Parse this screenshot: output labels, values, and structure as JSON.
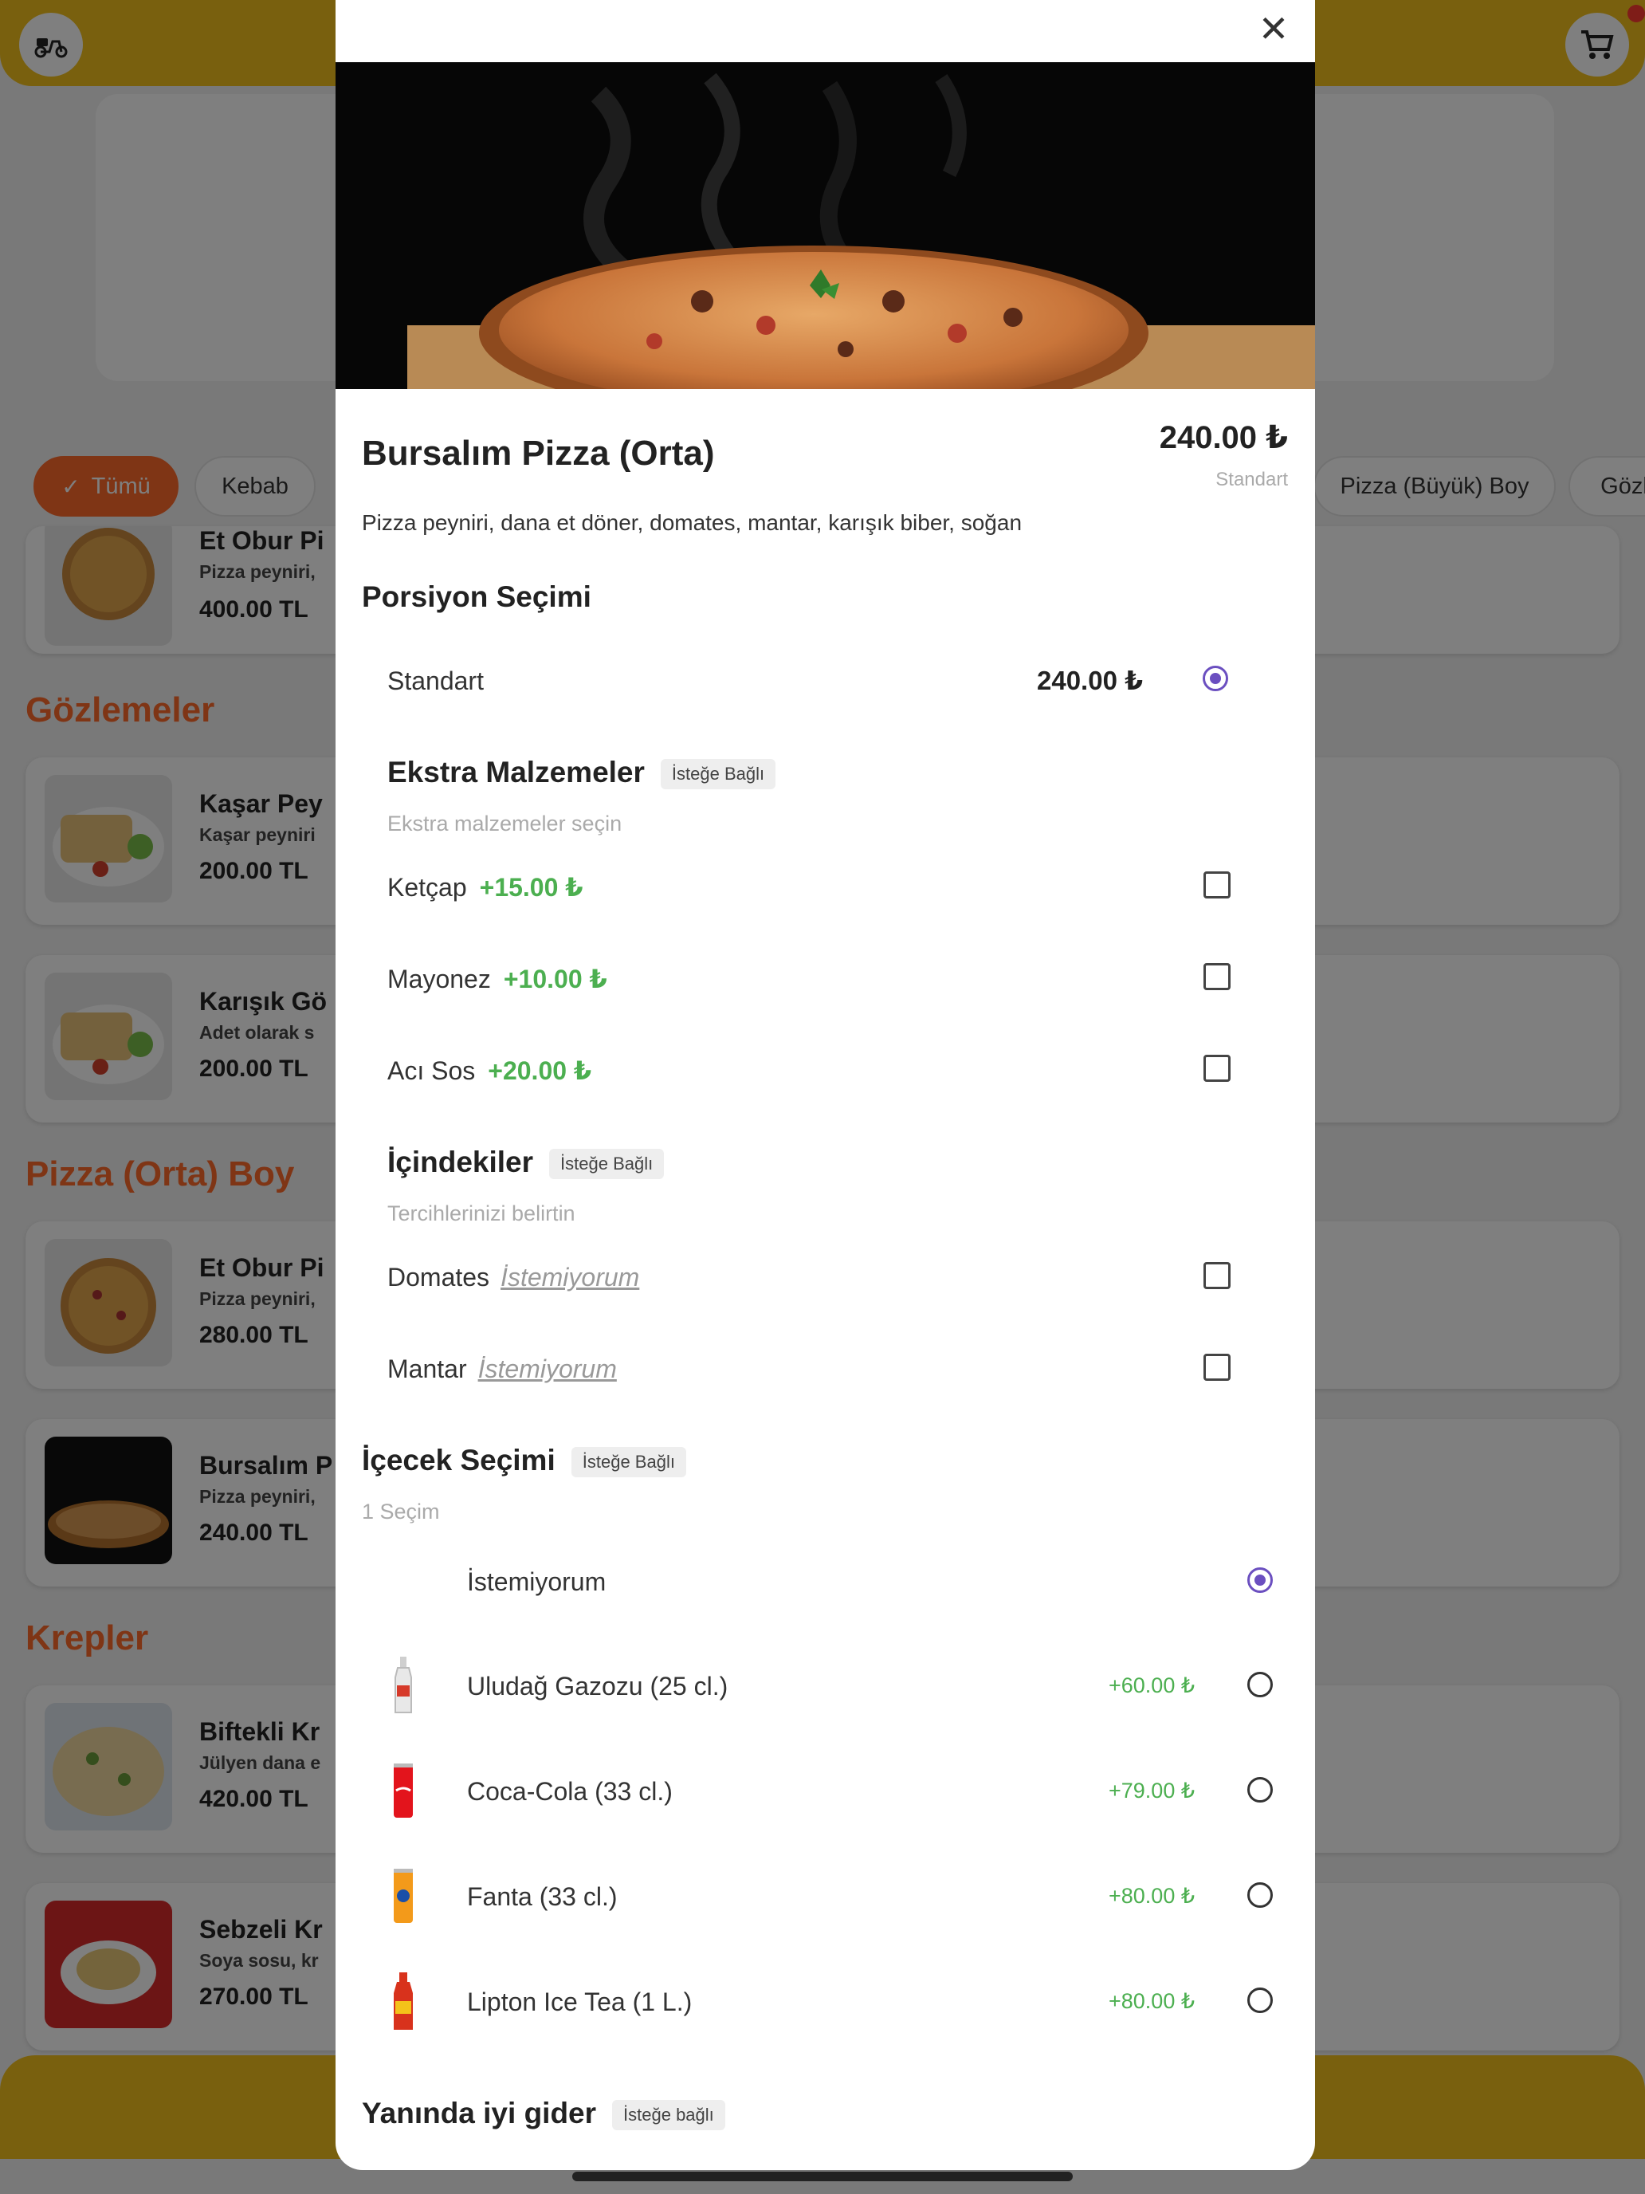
{
  "background": {
    "chips": [
      {
        "label": "Tümü",
        "active": true
      },
      {
        "label": "Kebab",
        "active": false
      },
      {
        "label": "Pizza (Büyük) Boy",
        "active": false
      },
      {
        "label": "Gözl",
        "active": false
      }
    ],
    "sections": [
      {
        "title": "Gözlemeler"
      },
      {
        "title": "Pizza (Orta) Boy"
      },
      {
        "title": "Krepler"
      }
    ],
    "items": [
      {
        "name": "Et Obur Pi",
        "desc": "Pizza peyniri,",
        "price": "400.00 TL"
      },
      {
        "name": "Kaşar Pey",
        "desc": "Kaşar peyniri",
        "price": "200.00 TL"
      },
      {
        "name": "Karışık Gö",
        "desc": "Adet olarak s",
        "price": "200.00 TL"
      },
      {
        "name": "Et Obur Pi",
        "desc": "Pizza peyniri,",
        "price": "280.00 TL"
      },
      {
        "name": "Bursalım P",
        "desc": "Pizza peyniri,",
        "price": "240.00 TL"
      },
      {
        "name": "Biftekli Kr",
        "desc": "Jülyen dana e",
        "price": "420.00 TL"
      },
      {
        "name": "Sebzeli Kr",
        "desc": "Soya sosu, kr",
        "price": "270.00 TL"
      }
    ]
  },
  "modal": {
    "close_symbol": "✕",
    "title": "Bursalım Pizza (Orta)",
    "price": "240.00 ₺",
    "price_note": "Standart",
    "description": "Pizza peyniri, dana et döner, domates, mantar, karışık biber, soğan",
    "portion": {
      "heading": "Porsiyon Seçimi",
      "options": [
        {
          "label": "Standart",
          "price": "240.00 ₺",
          "selected": true
        }
      ]
    },
    "extras": {
      "heading": "Ekstra Malzemeler",
      "tag": "İsteğe Bağlı",
      "subtitle": "Ekstra malzemeler seçin",
      "options": [
        {
          "label": "Ketçap",
          "price": "+15.00 ₺",
          "checked": false
        },
        {
          "label": "Mayonez",
          "price": "+10.00 ₺",
          "checked": false
        },
        {
          "label": "Acı Sos",
          "price": "+20.00 ₺",
          "checked": false
        }
      ]
    },
    "ingredients": {
      "heading": "İçindekiler",
      "tag": "İsteğe Bağlı",
      "subtitle": "Tercihlerinizi belirtin",
      "options": [
        {
          "label": "Domates",
          "note": "İstemiyorum",
          "checked": false
        },
        {
          "label": "Mantar",
          "note": "İstemiyorum",
          "checked": false
        }
      ]
    },
    "drinks": {
      "heading": "İçecek Seçimi",
      "tag": "İsteğe Bağlı",
      "subtitle": "1 Seçim",
      "options": [
        {
          "label": "İstemiyorum",
          "price": "",
          "selected": true,
          "icon": "none"
        },
        {
          "label": "Uludağ Gazozu (25 cl.)",
          "price": "+60.00 ₺",
          "selected": false,
          "icon": "glass-bottle-icon",
          "color": "#e8e8e8"
        },
        {
          "label": "Coca-Cola (33 cl.)",
          "price": "+79.00 ₺",
          "selected": false,
          "icon": "can-icon",
          "color": "#e3141c"
        },
        {
          "label": "Fanta (33 cl.)",
          "price": "+80.00 ₺",
          "selected": false,
          "icon": "can-icon",
          "color": "#f39a1a"
        },
        {
          "label": "Lipton Ice Tea (1 L.)",
          "price": "+80.00 ₺",
          "selected": false,
          "icon": "bottle-icon",
          "color": "#d8321c"
        }
      ]
    },
    "sides": {
      "heading": "Yanında iyi gider",
      "tag": "İsteğe bağlı"
    }
  },
  "colors": {
    "accent": "#ff6a2b",
    "topbar": "#f2c01c",
    "selection": "#6b4fc0",
    "extra_price": "#4caf50"
  }
}
